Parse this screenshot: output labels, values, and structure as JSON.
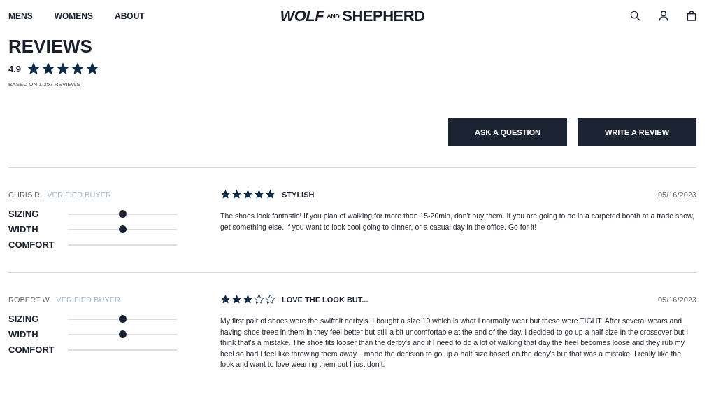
{
  "nav": {
    "links": [
      "MENS",
      "WOMENS",
      "ABOUT"
    ],
    "logo": {
      "first": "WOLF",
      "middle": "AND",
      "last": "SHEPHERD"
    }
  },
  "summary": {
    "title": "REVIEWS",
    "rating": "4.9",
    "stars": 5,
    "based_on": "BASED ON 1,257 REVIEWS"
  },
  "actions": [
    "ASK A QUESTION",
    "WRITE A REVIEW"
  ],
  "reviews": [
    {
      "author": "CHRIS R.",
      "badge": "VERIFIED BUYER",
      "stars": 5,
      "title": "STYLISH",
      "date": "05/16/2023",
      "body": "The shoes look fantastic! If you plan of walking for more than 15-20min, don't buy them. If you are going to be in a carpeted booth at a trade show, get something else. If you want to look cool going to dinner, or a casual day in the office. Go for it!",
      "attributes": [
        {
          "label": "SIZING",
          "level": 0.5
        },
        {
          "label": "WIDTH",
          "level": 0.5
        },
        {
          "label": "COMFORT"
        }
      ]
    },
    {
      "author": "ROBERT W.",
      "badge": "VERIFIED BUYER",
      "stars": 3,
      "title": "LOVE THE LOOK BUT...",
      "date": "05/16/2023",
      "body": "My first pair of shoes were the swiftnit derby's. I bought a size 10 which is what I normally wear but these were TIGHT. After several wears and having shoe trees in them in they feel better but still a bit uncomfortable at the end of the day. I decided to go up a half size in the crossover but I think that's a mistake. The shoe fits looser than the derby's and if I need to do a lot of walking that day the heel becomes loose and they rub my heel so bad I feel like throwing them away. I made the decision to go up a half size based on the deby's but that was a mistake. I really like the look and want to love wearing them but I just don't.",
      "attributes": [
        {
          "label": "SIZING",
          "level": 0.5
        },
        {
          "label": "WIDTH",
          "level": 0.5
        },
        {
          "label": "COMFORT"
        }
      ]
    }
  ]
}
